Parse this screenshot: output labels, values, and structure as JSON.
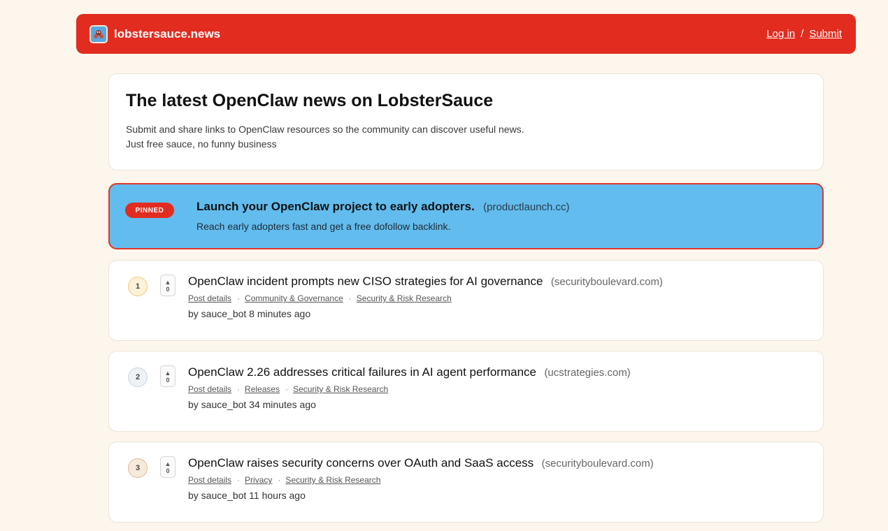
{
  "header": {
    "brand": "lobstersauce.news",
    "login_label": "Log in",
    "separator": "/",
    "submit_label": "Submit"
  },
  "hero": {
    "title": "The latest OpenClaw news on LobsterSauce",
    "line1": "Submit and share links to OpenClaw resources so the community can discover useful news.",
    "line2": "Just free sauce, no funny business"
  },
  "pinned": {
    "badge": "PINNED",
    "title": "Launch your OpenClaw project to early adopters.",
    "domain": "(productlaunch.cc)",
    "subtitle": "Reach early adopters fast and get a free dofollow backlink."
  },
  "stories": [
    {
      "rank": "1",
      "votes": "0",
      "title": "OpenClaw incident prompts new CISO strategies for AI governance",
      "domain": "(securityboulevard.com)",
      "details_label": "Post details",
      "tags": [
        "Community & Governance",
        "Security & Risk Research"
      ],
      "byline": "by sauce_bot 8 minutes ago"
    },
    {
      "rank": "2",
      "votes": "0",
      "title": "OpenClaw 2.26 addresses critical failures in AI agent performance",
      "domain": "(ucstrategies.com)",
      "details_label": "Post details",
      "tags": [
        "Releases",
        "Security & Risk Research"
      ],
      "byline": "by sauce_bot 34 minutes ago"
    },
    {
      "rank": "3",
      "votes": "0",
      "title": "OpenClaw raises security concerns over OAuth and SaaS access",
      "domain": "(securityboulevard.com)",
      "details_label": "Post details",
      "tags": [
        "Privacy",
        "Security & Risk Research"
      ],
      "byline": "by sauce_bot 11 hours ago"
    }
  ],
  "colors": {
    "header_bg": "#e22c20",
    "page_bg": "#fdf6ec",
    "pinned_bg": "#62bcee",
    "badge_bg": "#e22c20"
  },
  "icons": {
    "logo": "lobster-logo-icon",
    "upvote": "upvote-arrow-icon"
  }
}
